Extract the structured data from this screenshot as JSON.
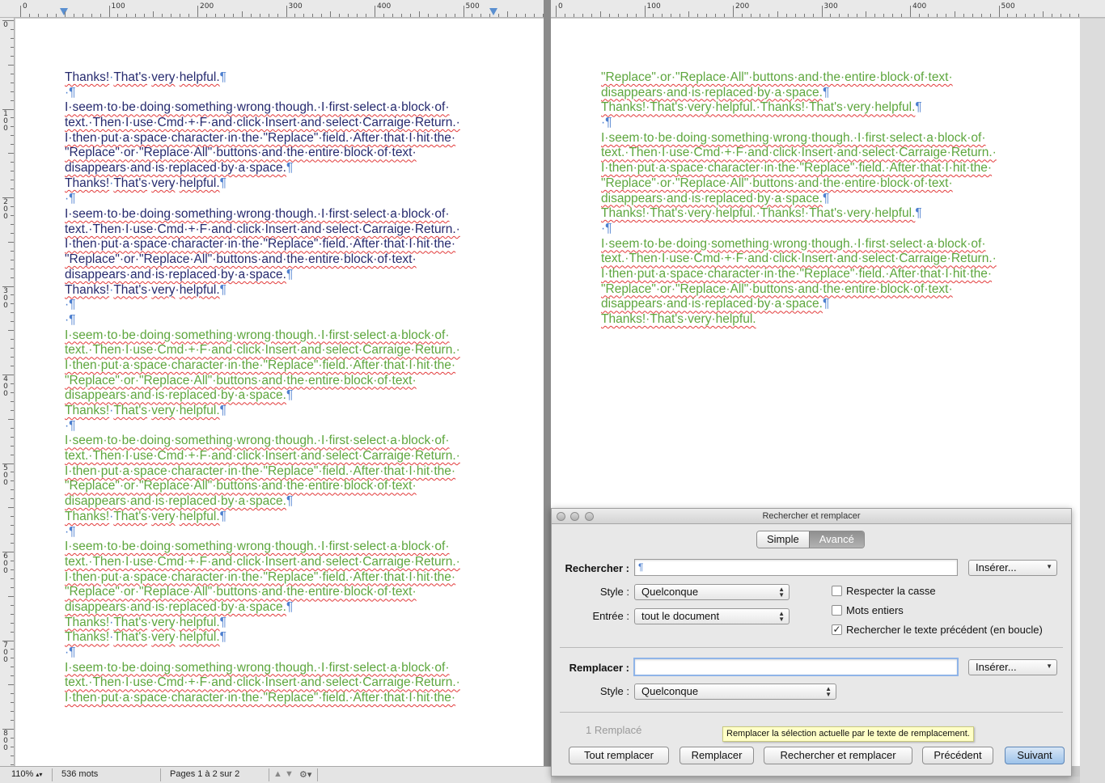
{
  "ruler_left": {
    "labels": [
      "0",
      "100",
      "200",
      "300",
      "400",
      "500"
    ]
  },
  "ruler_right": {
    "labels": [
      "0",
      "100",
      "200",
      "300",
      "400",
      "500"
    ]
  },
  "ruler_vertical": {
    "labels": [
      "0",
      "100",
      "200",
      "300",
      "400",
      "500",
      "600",
      "700",
      "800"
    ]
  },
  "doc": {
    "s_thanks": "Thanks!",
    "s_sep": "·",
    "s_thats": "That's",
    "s_very": "very",
    "s_helpful": "helpful.",
    "s_tail": "·",
    "s_pm": "¶",
    "s_brk": "·¶",
    "s_brk2": "·¶",
    "s_pmonly": "¶",
    "l1a": "I·seem·to·be·doing·something·wrong·though.·I·first·select·a·block·of·",
    "l2a": "text.·Then·I·use·Cmd·+·F·and·click·Insert·and·select·Carraige·Return.·",
    "l3a": "I·then·put·a·space·character·in·the·\"Replace\"·field.·After·that·I·hit·the·",
    "l4a": "\"Replace\"·or·\"Replace·All\"·buttons·and·the·entire·block·of·text·",
    "l5a": "disappears·and·is·replaced·by·a·space.",
    "r_first": "\"Replace\"·or·\"Replace·All\"·buttons·and·the·entire·block·of·text·",
    "r_second": "disappears·and·is·replaced·by·a·space.",
    "r_double": "Thanks!·That's·very·helpful.·Thanks!·That's·very·helpful.",
    "r_last": "Thanks!·That's·very·helpful."
  },
  "statusbar": {
    "zoom": "110%",
    "words": "536 mots",
    "pages": "Pages 1 à 2 sur 2"
  },
  "dialog": {
    "title": "Rechercher et remplacer",
    "tab_simple": "Simple",
    "tab_advanced": "Avancé",
    "search_label": "Rechercher :",
    "search_value": "¶",
    "insert_label": "Insérer...",
    "style_label": "Style :",
    "style_value": "Quelconque",
    "scope_label": "Entrée :",
    "scope_value": "tout le document",
    "opt_case": "Respecter la casse",
    "opt_words": "Mots entiers",
    "opt_wrap": "Rechercher le texte précédent (en boucle)",
    "opt_wrap_checked": "✓",
    "replace_label": "Remplacer :",
    "replace_value": "",
    "replace_insert_label": "Insérer...",
    "replace_style_label": "Style :",
    "replace_style_value": "Quelconque",
    "count": "1 Remplacé",
    "btn_replace_all": "Tout remplacer",
    "btn_replace": "Remplacer",
    "btn_find_replace": "Rechercher et remplacer",
    "btn_prev": "Précédent",
    "btn_next": "Suivant",
    "tooltip": "Remplacer la sélection actuelle par le texte de remplacement."
  }
}
